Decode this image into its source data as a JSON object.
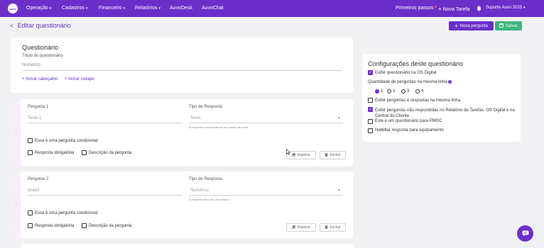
{
  "nav": {
    "logo_text": "auvo",
    "items": [
      {
        "label": "Operação",
        "chevron": "chevron-down-icon"
      },
      {
        "label": "Cadastros",
        "chevron": "chevron-down-icon"
      },
      {
        "label": "Financeiro",
        "chevron": "chevron-down-icon"
      },
      {
        "label": "Relatórios",
        "chevron": "chevron-down-icon"
      },
      {
        "label": "AuvoDesk"
      },
      {
        "label": "AuvoChat"
      }
    ],
    "first_steps": "Primeiros passos",
    "new_task": "Nova Tarefa",
    "user": "Suporte Auvo 2025",
    "color": "#6b2fc9"
  },
  "header": {
    "title": "Editar questionário",
    "new_question": "Nova pergunta",
    "save": "Salvar"
  },
  "questionnaire": {
    "heading": "Questionário",
    "title_label": "Título do questionário",
    "title_value": "Numérico",
    "include_header": "+ Incluir cabeçalho",
    "include_footer": "+ Incluir rodapé"
  },
  "questions": [
    {
      "label": "Pergunta 1",
      "value": "Teste 1",
      "type_label": "Tipo de Resposta",
      "type_value": "Texto",
      "helper": "A resposta é informada em um campo de texto",
      "conditional": "Essa é uma pergunta condicional",
      "required": "Resposta obrigatória",
      "description": "Descrição da pergunta",
      "duplicate": "Duplicar",
      "delete": "Excluir"
    },
    {
      "label": "Pergunta 2",
      "value": "teste3",
      "type_label": "Tipo de Resposta",
      "type_value": "Numérico",
      "helper": "A resposta deve ser um número",
      "conditional": "Essa é uma pergunta condicional",
      "required": "Resposta obrigatória",
      "description": "Descrição da pergunta",
      "duplicate": "Duplicar",
      "delete": "Excluir"
    }
  ],
  "settings": {
    "title": "Configurações deste questionário",
    "show_os": "Exibir questionário na OS Digital",
    "qty_label": "Quantidade de perguntas na mesma linha",
    "qty_options": [
      "1",
      "2",
      "3",
      "4"
    ],
    "qty_selected": "1",
    "same_line": "Exibir perguntas e respostas na mesma linha",
    "unanswered": "Exibir perguntas não respondidas no Relatório de Tarefas, OS Digital e na Central do Cliente",
    "pmoc": "Este é um questionário para PMOC",
    "equipment": "Habilitar resposta para equipamento"
  }
}
